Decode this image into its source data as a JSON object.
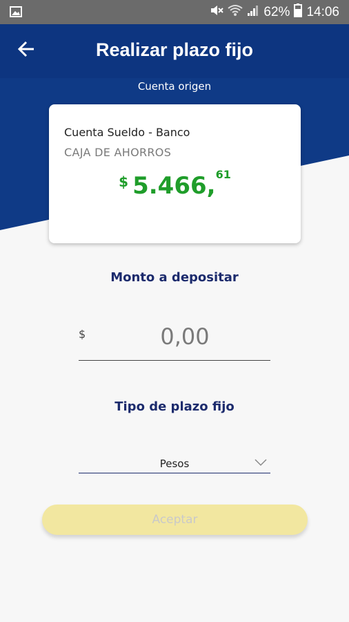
{
  "status_bar": {
    "battery": "62%",
    "time": "14:06",
    "icons": [
      "image-icon",
      "mute-icon",
      "wifi-icon",
      "signal-icon",
      "battery-icon"
    ]
  },
  "header": {
    "title": "Realizar plazo fijo",
    "back_icon": "arrow-left-icon"
  },
  "source_account": {
    "label": "Cuenta origen",
    "name": "Cuenta Sueldo - Banco",
    "type": "CAJA DE AHORROS",
    "currency": "$",
    "balance_integer": "5.466,",
    "balance_cents": "61"
  },
  "amount": {
    "label": "Monto a depositar",
    "currency": "$",
    "placeholder": "0,00",
    "value": ""
  },
  "term_type": {
    "label": "Tipo de plazo fijo",
    "selected": "Pesos",
    "icon": "chevron-down-icon"
  },
  "actions": {
    "accept_label": "Aceptar"
  },
  "colors": {
    "primary_blue": "#0f3a86",
    "balance_green": "#1f9d2a",
    "label_navy": "#1c2b6d",
    "button_yellow": "#f2e7a0"
  }
}
